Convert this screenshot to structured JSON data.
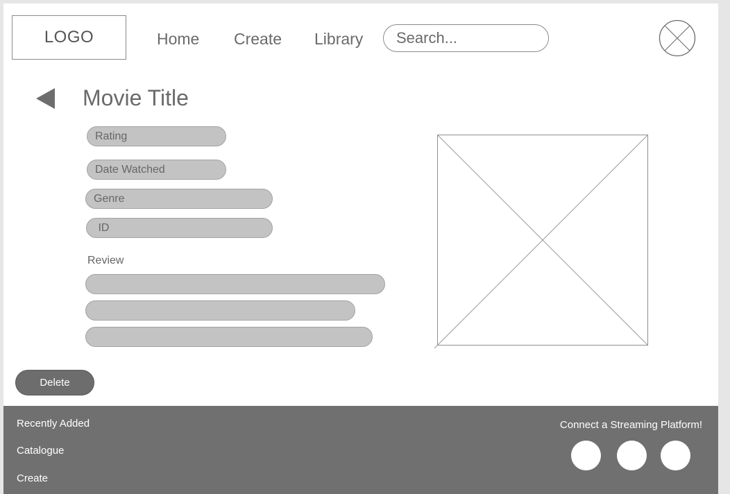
{
  "header": {
    "logo": "LOGO",
    "nav": [
      {
        "label": "Home"
      },
      {
        "label": "Create"
      },
      {
        "label": "Library"
      }
    ],
    "search": {
      "placeholder": "Search...",
      "value": ""
    },
    "avatar_icon": "image-placeholder-circle-icon"
  },
  "main": {
    "back_icon": "back-arrow-icon",
    "title": "Movie Title",
    "fields": [
      {
        "label": "Rating"
      },
      {
        "label": "Date Watched"
      },
      {
        "label": "Genre"
      },
      {
        "label": " ID"
      }
    ],
    "review_label": "Review",
    "review_lines": 3,
    "image_icon": "image-placeholder-icon",
    "delete_label": "Delete"
  },
  "footer": {
    "links": [
      {
        "label": "Recently Added"
      },
      {
        "label": "Catalogue"
      },
      {
        "label": "Create"
      }
    ],
    "connect_label": "Connect a Streaming Platform!",
    "platforms": 3
  },
  "colors": {
    "footer_bg": "#707070",
    "pill_bg": "#c3c3c3",
    "button_bg": "#6d6d6d",
    "text": "#6a6a6a"
  }
}
